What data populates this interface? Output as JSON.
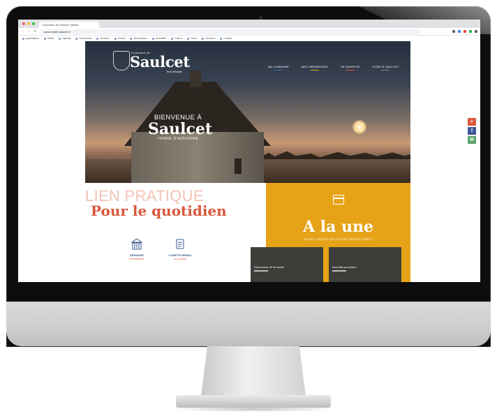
{
  "browser": {
    "tab_title": "Commune de Saulcet | Mairie",
    "url": "www.mairie-saulcet.fr",
    "bookmarks": [
      "Applications",
      "Mairie",
      "Agenda",
      "Démarches",
      "Services",
      "Écoles",
      "Associations",
      "Actualités",
      "Culture",
      "Sport",
      "Tourisme",
      "Contact"
    ],
    "window_dot_colors": [
      "#ff5f57",
      "#febc2e",
      "#28c840"
    ]
  },
  "site": {
    "logo": {
      "top_text": "Commune de",
      "name": "Saulcet",
      "sub_text": "Terre d'histoire"
    },
    "nav": [
      {
        "label": "MA COMMUNE",
        "color": "#3a6fb0"
      },
      {
        "label": "MES DÉMARCHES",
        "color": "#e6a318"
      },
      {
        "label": "SE DIVERTIR",
        "color": "#d8583b"
      },
      {
        "label": "VIVRE À SAULCET",
        "color": "#888888"
      }
    ],
    "hero": {
      "welcome": "BIENVENUE À",
      "name": "Saulcet",
      "subtitle": "TERRE D'HISTOIRE"
    },
    "social": [
      {
        "icon": "search-icon",
        "glyph": "⌕",
        "color": "#d8583b"
      },
      {
        "icon": "facebook-icon",
        "glyph": "f",
        "color": "#3b5998"
      },
      {
        "icon": "mail-icon",
        "glyph": "✉",
        "color": "#5aa36b"
      }
    ],
    "lien_pratique": {
      "line1": "LIEN PRATIQUE",
      "line2": "Pour le quotidien"
    },
    "quick_links": [
      {
        "label_a": "DEMANDE",
        "label_b": "d'urbanisme",
        "icon": "building-icon"
      },
      {
        "label_a": "COMPTE-RENDU",
        "label_b": "du conseil",
        "icon": "document-icon"
      }
    ],
    "a_la_une": {
      "title": "A la une",
      "subtitle": "SUIVEZ TOUTES LES ACTUALITÉS EN DIRECT",
      "news": [
        {
          "title": "Découverte de la fauche"
        },
        {
          "title": "Nouvelle procédure"
        }
      ]
    }
  }
}
